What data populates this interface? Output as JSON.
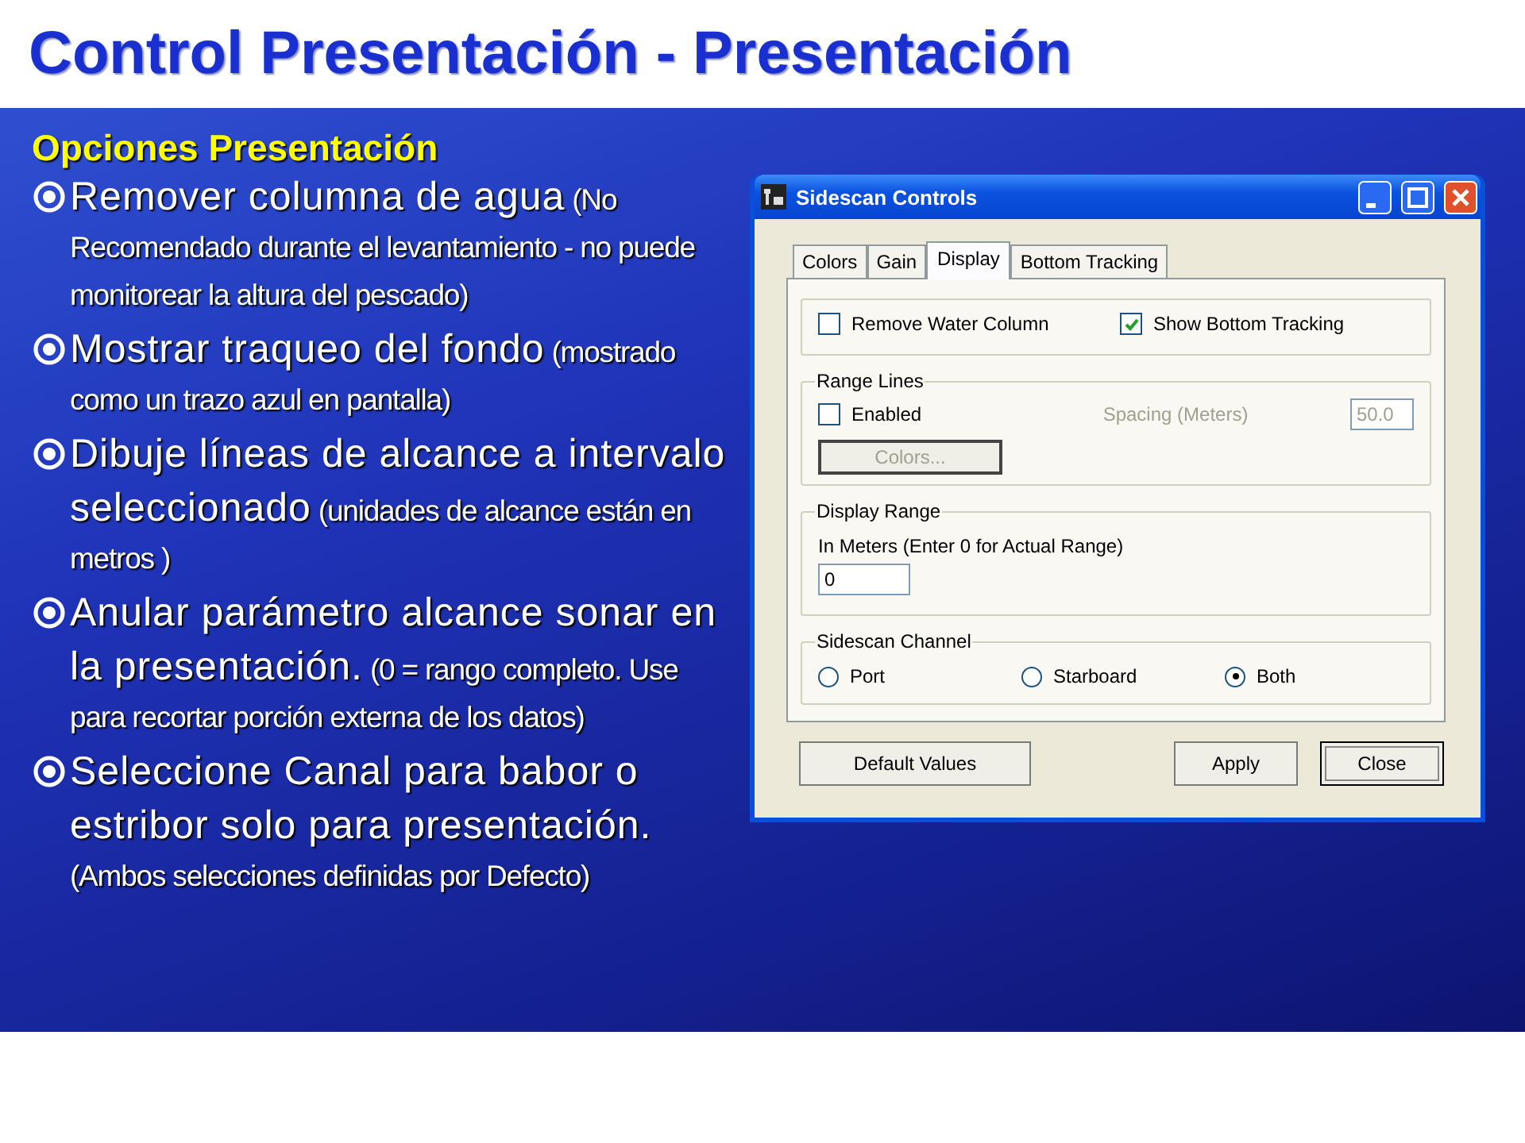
{
  "slide_title": "Control Presentación - Presentación",
  "heading": "Opciones Presentación",
  "bullets": [
    {
      "text": "Remover columna de agua",
      "note": "(No Recomendado durante el levantamiento - no puede monitorear la altura del pescado)"
    },
    {
      "text": "Mostrar traqueo del fondo",
      "note": "(mostrado como un trazo azul en pantalla)"
    },
    {
      "text": "Dibuje líneas de alcance a intervalo seleccionado",
      "note": "(unidades de alcance están en metros )"
    },
    {
      "text": "Anular parámetro alcance sonar en la presentación.",
      "note": "(0 = rango completo. Use para recortar porción externa de los datos)"
    },
    {
      "text": "Seleccione Canal para babor o estribor solo para presentación.",
      "note": "(Ambos selecciones definidas por Defecto)"
    }
  ],
  "dialog": {
    "title": "Sidescan Controls",
    "tabs": [
      {
        "label": "Colors",
        "selected": false
      },
      {
        "label": "Gain",
        "selected": false
      },
      {
        "label": "Display",
        "selected": true
      },
      {
        "label": "Bottom Tracking",
        "selected": false
      }
    ],
    "options": [
      {
        "label": "Remove Water Column",
        "checked": false
      },
      {
        "label": "Show Bottom Tracking",
        "checked": true
      }
    ],
    "range_lines": {
      "title": "Range Lines",
      "enabled": {
        "label": "Enabled",
        "checked": false
      },
      "disabled": true,
      "spacing_label": "Spacing (Meters)",
      "spacing_value": "50.0",
      "colors_button": "Colors..."
    },
    "display_range": {
      "title": "Display Range",
      "hint": "In Meters (Enter 0 for Actual Range)",
      "value": "0"
    },
    "channel": {
      "title": "Sidescan Channel",
      "options": [
        {
          "label": "Port",
          "selected": false
        },
        {
          "label": "Starboard",
          "selected": false
        },
        {
          "label": "Both",
          "selected": true
        }
      ]
    },
    "buttons": [
      {
        "label": "Default Values",
        "focused": false
      },
      {
        "label": "Apply",
        "focused": false
      },
      {
        "label": "Close",
        "focused": true
      }
    ]
  }
}
